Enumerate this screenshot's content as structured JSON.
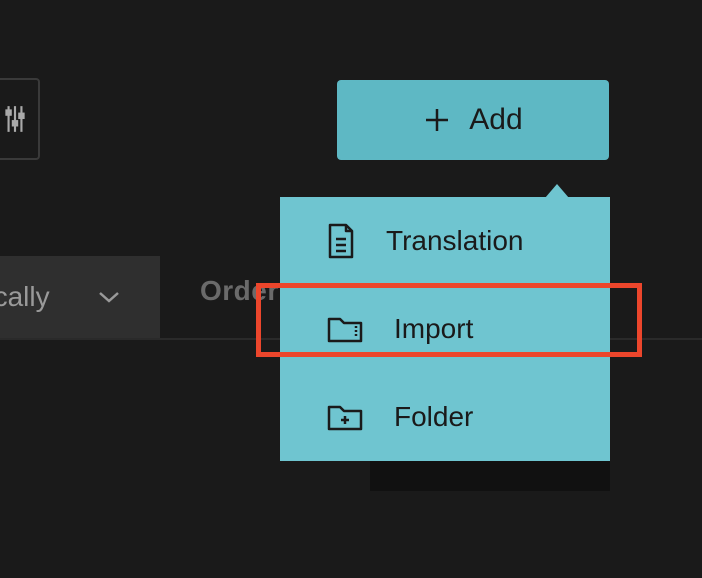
{
  "add_button": {
    "label": "Add"
  },
  "dropdown": {
    "items": [
      {
        "label": "Translation"
      },
      {
        "label": "Import"
      },
      {
        "label": "Folder"
      }
    ]
  },
  "sort": {
    "visible_text": "etically"
  },
  "order_label": "Order",
  "colors": {
    "accent": "#5eb8c4",
    "dropdown": "#6fc5d0",
    "highlight": "#ec462c",
    "background": "#1a1a1a"
  }
}
